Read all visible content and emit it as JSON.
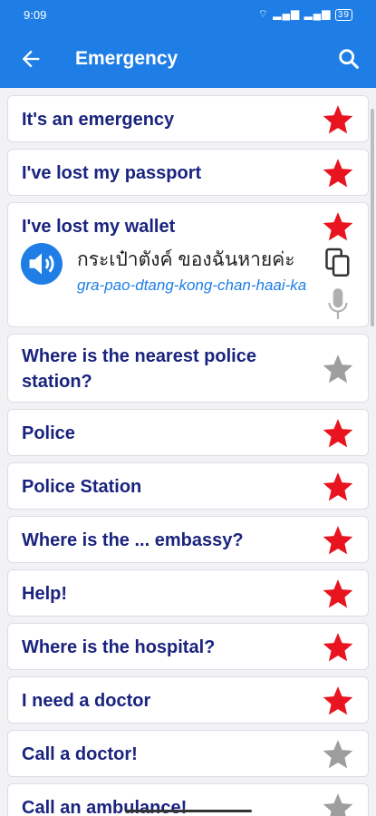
{
  "status_bar": {
    "time": "9:09",
    "battery": "39"
  },
  "app_bar": {
    "title": "Emergency"
  },
  "phrases": [
    {
      "text": "It's an emergency",
      "favorite": true
    },
    {
      "text": "I've lost my passport",
      "favorite": true
    },
    {
      "text": "I've lost my wallet",
      "favorite": true,
      "thai": "กระเป๋าตังค์ ของฉันหายค่ะ",
      "transliteration": "gra-pao-dtang-kong-chan-haai-ka"
    },
    {
      "text": "Where is the nearest police station?",
      "favorite": false
    },
    {
      "text": "Police",
      "favorite": true
    },
    {
      "text": "Police Station",
      "favorite": true
    },
    {
      "text": "Where is the ... embassy?",
      "favorite": true
    },
    {
      "text": "Help!",
      "favorite": true
    },
    {
      "text": "Where is the hospital?",
      "favorite": true
    },
    {
      "text": "I need a doctor",
      "favorite": true
    },
    {
      "text": "Call a doctor!",
      "favorite": false
    },
    {
      "text": "Call an ambulance!",
      "favorite": false
    }
  ],
  "colors": {
    "accent": "#1f7ee6",
    "phrase_text": "#1a237e",
    "star_on": "#e8141f",
    "star_off": "#9e9e9e"
  }
}
